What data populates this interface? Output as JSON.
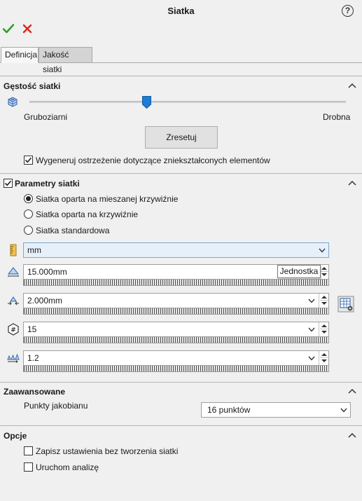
{
  "header": {
    "title": "Siatka",
    "help_icon": "?"
  },
  "toolbar": {
    "ok_icon": "check-icon",
    "cancel_icon": "close-icon",
    "accent_ok": "#2e9e2e",
    "accent_cancel": "#d9261c"
  },
  "tabs": [
    {
      "label": "Definicja",
      "active": true
    },
    {
      "label": "Jakość siatki",
      "active": false
    }
  ],
  "density": {
    "title": "Gęstość siatki",
    "left_label": "Gruboziarni",
    "right_label": "Drobna",
    "slider_value": 0.37,
    "reset_label": "Zresetuj",
    "regen_label": "Wygeneruj ostrzeżenie dotyczące zniekształconych elementów",
    "regen_checked": true
  },
  "params": {
    "title": "Parametry siatki",
    "checked": true,
    "options": [
      {
        "label": "Siatka oparta na mieszanej krzywiźnie",
        "selected": true
      },
      {
        "label": "Siatka oparta na krzywiźnie",
        "selected": false
      },
      {
        "label": "Siatka standardowa",
        "selected": false
      }
    ],
    "unit": "mm",
    "max_size": "15.000mm",
    "min_size": "2.000mm",
    "min_elements": "15",
    "growth_ratio": "1.2",
    "tooltip": "Jednostka"
  },
  "advanced": {
    "title": "Zaawansowane",
    "jacobian_label": "Punkty jakobianu",
    "jacobian_value": "16 punktów"
  },
  "options": {
    "title": "Opcje",
    "save_label": "Zapisz ustawienia bez tworzenia siatki",
    "save_checked": false,
    "run_label": "Uruchom analizę",
    "run_checked": false
  }
}
